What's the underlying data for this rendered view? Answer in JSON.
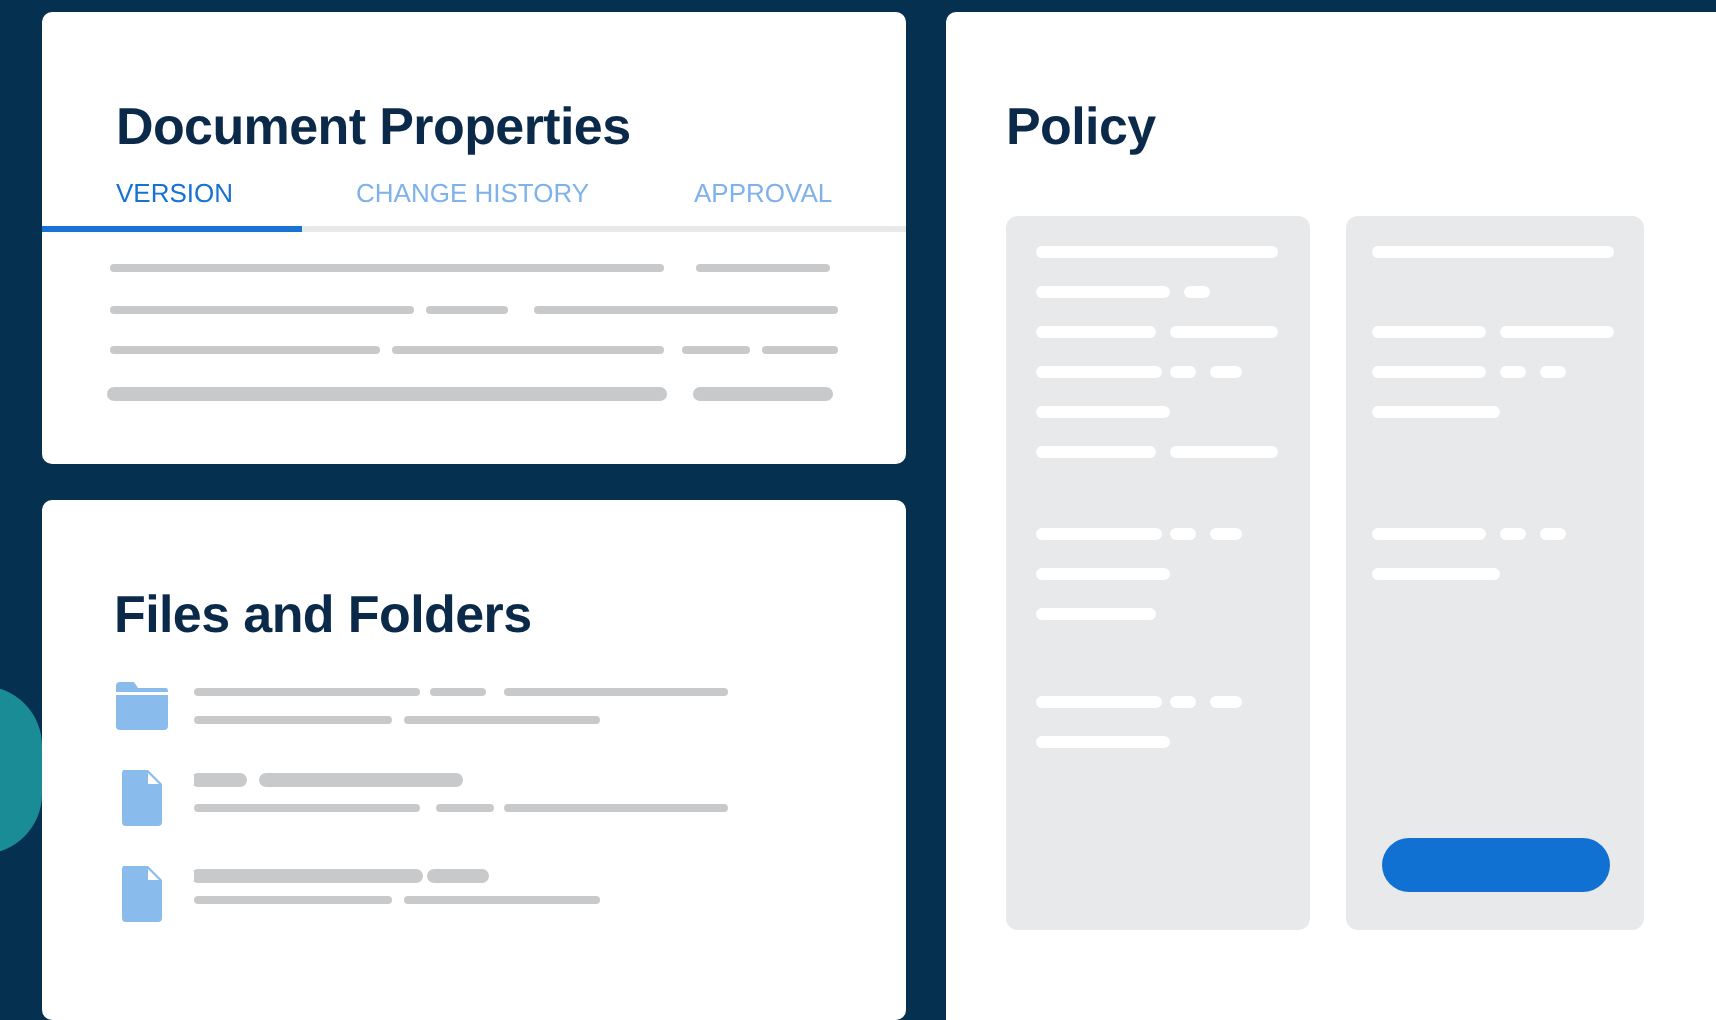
{
  "document_properties": {
    "title": "Document Properties",
    "tabs": [
      {
        "label": "VERSION",
        "selected": true
      },
      {
        "label": "CHANGE HISTORY",
        "selected": false
      },
      {
        "label": "APPROVAL",
        "selected": false
      }
    ]
  },
  "files_and_folders": {
    "title": "Files and Folders",
    "items": [
      {
        "kind": "folder"
      },
      {
        "kind": "file"
      },
      {
        "kind": "file"
      }
    ]
  },
  "policy": {
    "title": "Policy"
  }
}
